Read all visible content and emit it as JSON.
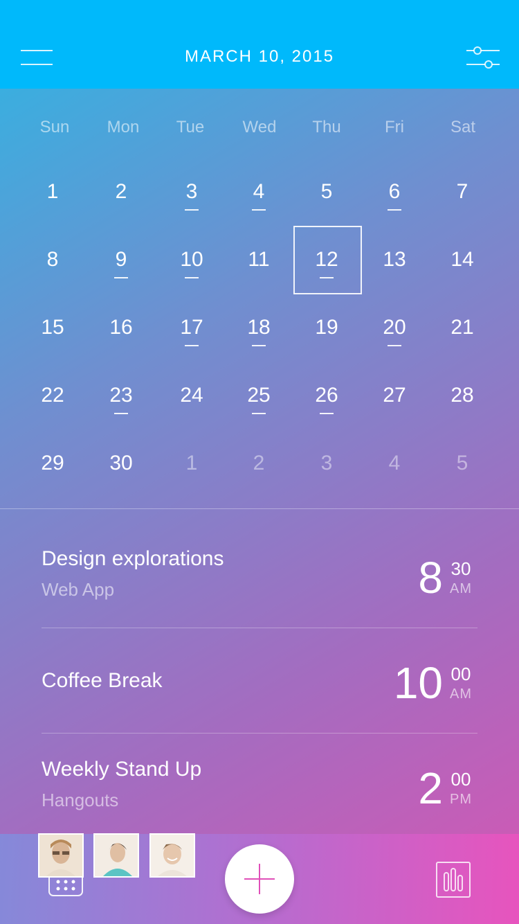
{
  "header": {
    "title": "MARCH 10, 2015",
    "menu_icon": "hamburger-menu-icon",
    "filter_icon": "sliders-filter-icon"
  },
  "calendar": {
    "weekdays": [
      "Sun",
      "Mon",
      "Tue",
      "Wed",
      "Thu",
      "Fri",
      "Sat"
    ],
    "weeks": [
      [
        {
          "label": "1"
        },
        {
          "label": "2"
        },
        {
          "label": "3",
          "event": true
        },
        {
          "label": "4",
          "event": true
        },
        {
          "label": "5"
        },
        {
          "label": "6",
          "event": true
        },
        {
          "label": "7"
        }
      ],
      [
        {
          "label": "8"
        },
        {
          "label": "9",
          "event": true
        },
        {
          "label": "10",
          "event": true
        },
        {
          "label": "11"
        },
        {
          "label": "12",
          "event": true,
          "selected": true
        },
        {
          "label": "13"
        },
        {
          "label": "14"
        }
      ],
      [
        {
          "label": "15"
        },
        {
          "label": "16"
        },
        {
          "label": "17",
          "event": true
        },
        {
          "label": "18",
          "event": true
        },
        {
          "label": "19"
        },
        {
          "label": "20",
          "event": true
        },
        {
          "label": "21"
        }
      ],
      [
        {
          "label": "22"
        },
        {
          "label": "23",
          "event": true
        },
        {
          "label": "24"
        },
        {
          "label": "25",
          "event": true
        },
        {
          "label": "26",
          "event": true
        },
        {
          "label": "27"
        },
        {
          "label": "28"
        }
      ],
      [
        {
          "label": "29"
        },
        {
          "label": "30"
        },
        {
          "label": "1",
          "muted": true
        },
        {
          "label": "2",
          "muted": true
        },
        {
          "label": "3",
          "muted": true
        },
        {
          "label": "4",
          "muted": true
        },
        {
          "label": "5",
          "muted": true
        }
      ]
    ]
  },
  "events": [
    {
      "title": "Design explorations",
      "subtitle": "Web App",
      "hour": "8",
      "minutes": "30",
      "ampm": "AM"
    },
    {
      "title": "Coffee Break",
      "subtitle": "",
      "hour": "10",
      "minutes": "00",
      "ampm": "AM"
    },
    {
      "title": "Weekly Stand Up",
      "subtitle": "Hangouts",
      "hour": "2",
      "minutes": "00",
      "ampm": "PM"
    }
  ],
  "bottom_bar": {
    "calendar_icon": "calendar-grid-icon",
    "add_icon": "plus-icon",
    "stats_icon": "bar-chart-icon",
    "avatars": [
      "avatar-person-1",
      "avatar-person-2",
      "avatar-person-3"
    ]
  },
  "colors": {
    "header": "#00b9fb",
    "accent": "#e04fb8",
    "gradient_start": "#2db6e3",
    "gradient_end": "#d656b3"
  }
}
